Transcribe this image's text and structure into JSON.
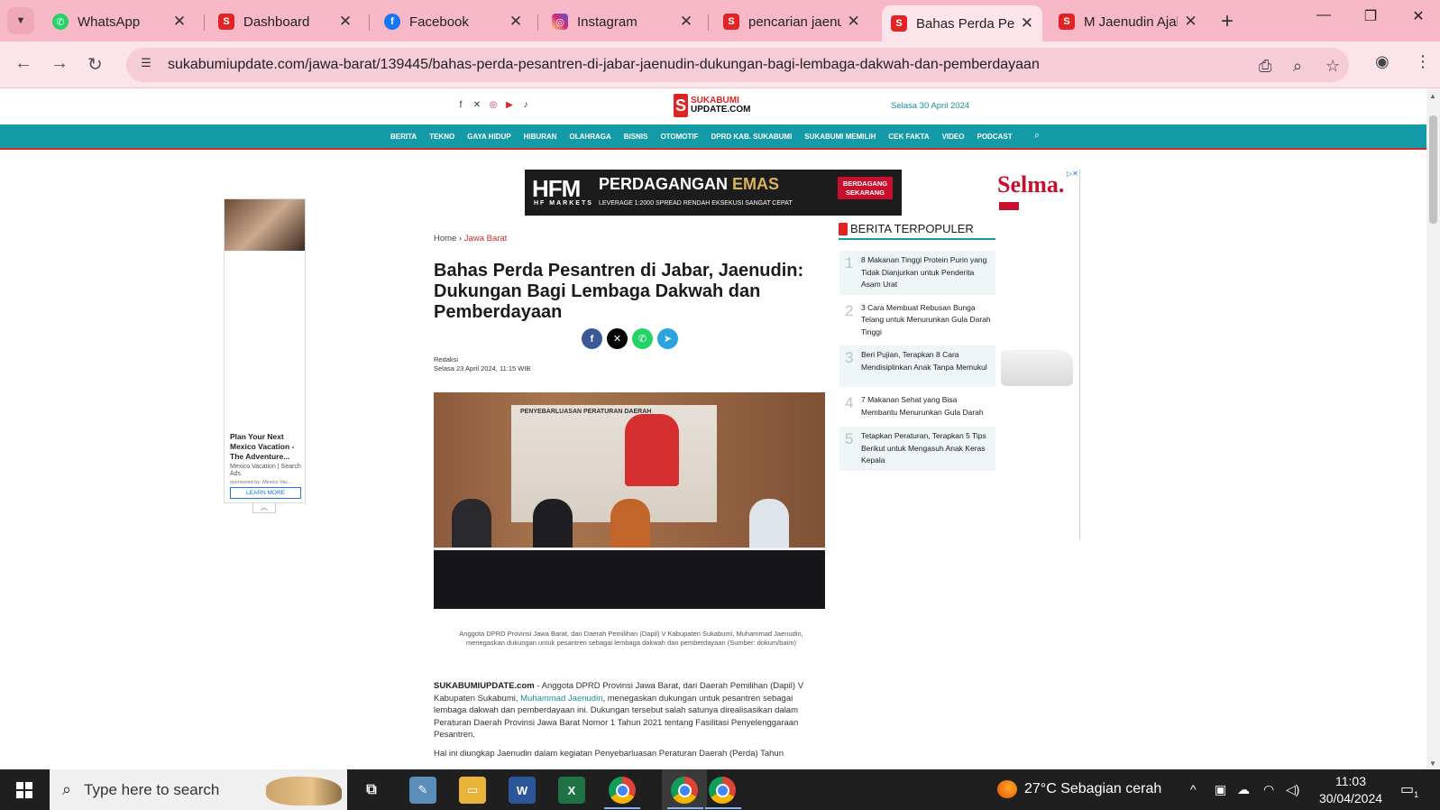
{
  "browser": {
    "tabs": [
      {
        "label": "WhatsApp",
        "icon": "whatsapp-icon",
        "color": "#25d366"
      },
      {
        "label": "Dashboard",
        "icon": "sukabumi-icon",
        "color": "#e02424"
      },
      {
        "label": "Facebook",
        "icon": "facebook-icon",
        "color": "#1877f2"
      },
      {
        "label": "Instagram",
        "icon": "instagram-icon",
        "color": "#d62976"
      },
      {
        "label": "pencarian jaenudin",
        "icon": "sukabumi-icon",
        "color": "#e02424"
      },
      {
        "label": "Bahas Perda Pesantren",
        "icon": "sukabumi-icon",
        "color": "#e02424",
        "active": true
      },
      {
        "label": "M Jaenudin Ajak",
        "icon": "sukabumi-icon",
        "color": "#e02424"
      }
    ],
    "url": "sukabumiupdate.com/jawa-barat/139445/bahas-perda-pesantren-di-jabar-jaenudin-dukungan-bagi-lembaga-dakwah-dan-pemberdayaan"
  },
  "site": {
    "logo_top": "SUKABUMI",
    "logo_bottom": "UPDATE.COM",
    "date": "Selasa 30 April 2024",
    "nav": [
      "BERITA",
      "TEKNO",
      "GAYA HIDUP",
      "HIBURAN",
      "OLAHRAGA",
      "BISNIS",
      "OTOMOTIF",
      "DPRD KAB. SUKABUMI",
      "SUKABUMI MEMILIH",
      "CEK FAKTA",
      "VIDEO",
      "PODCAST"
    ]
  },
  "ads": {
    "banner_brand": "HFM",
    "banner_brand_sub": "HF MARKETS",
    "banner_headline_a": "PERDAGANGAN",
    "banner_headline_b": "EMAS",
    "banner_features": "LEVERAGE 1:2000    SPREAD RENDAH    EKSEKUSI SANGAT CEPAT",
    "banner_cta": "BERDAGANG SEKARANG",
    "left_title": "Plan Your Next Mexico Vacation - The Adventure...",
    "left_sub": "Mexico Vacation | Search Ads",
    "left_sponsor": "sponsored by: Mexico Vac...",
    "left_cta": "LEARN MORE",
    "right_brand": "Selma."
  },
  "article": {
    "breadcrumb_home": "Home",
    "breadcrumb_section": "Jawa Barat",
    "title": "Bahas Perda Pesantren di Jabar, Jaenudin: Dukungan Bagi Lembaga Dakwah dan Pemberdayaan",
    "author": "Redaksi",
    "published": "Selasa 23 April 2024, 11:15 WIB",
    "photo_banner": "PENYEBARLUASAN PERATURAN DAERAH",
    "caption": "Anggota DPRD Provinsi Jawa Barat, dari Daerah Pemilihan (Dapil) V Kabupaten Sukabumi, Muhammad Jaenudin, menegaskan dukungan untuk pesantren sebagai lembaga dakwah dan pemberdayaan (Sumber: dokum/baim)",
    "lead_brand": "SUKABUMIUPDATE.com",
    "lead_part1": " - Anggota DPRD Provinsi Jawa Barat, dari Daerah Pemilihan (Dapil) V Kabupaten Sukabumi, ",
    "lead_link": "Muhammad Jaenudin",
    "lead_part2": ", menegaskan dukungan untuk pesantren sebagai lembaga dakwah dan pemberdayaan ini. Dukungan tersebut salah satunya direalisasikan dalam Peraturan Daerah Provinsi Jawa Barat Nomor 1 Tahun 2021 tentang Fasilitasi Penyelenggaraan Pesantren.",
    "para2": "Hal ini diungkap Jaenudin dalam kegiatan Penyebarluasan Peraturan Daerah (Perda) Tahun"
  },
  "popular": {
    "heading": "BERITA TERPOPULER",
    "items": [
      {
        "num": "1",
        "title": "8 Makanan Tinggi Protein Purin yang Tidak Dianjurkan untuk Penderita Asam Urat"
      },
      {
        "num": "2",
        "title": "3 Cara Membuat Rebusan Bunga Telang untuk Menurunkan Gula Darah Tinggi"
      },
      {
        "num": "3",
        "title": "Beri Pujian, Terapkan 8 Cara Mendisiplinkan Anak Tanpa Memukul"
      },
      {
        "num": "4",
        "title": "7 Makanan Sehat yang Bisa Membantu Menurunkan Gula Darah"
      },
      {
        "num": "5",
        "title": "Tetapkan Peraturan, Terapkan 5 Tips Berikut untuk Mengasuh Anak Keras Kepala"
      }
    ]
  },
  "taskbar": {
    "search_placeholder": "Type here to search",
    "weather": "27°C  Sebagian cerah",
    "time": "11:03",
    "date": "30/04/2024",
    "notif_count": "1"
  }
}
